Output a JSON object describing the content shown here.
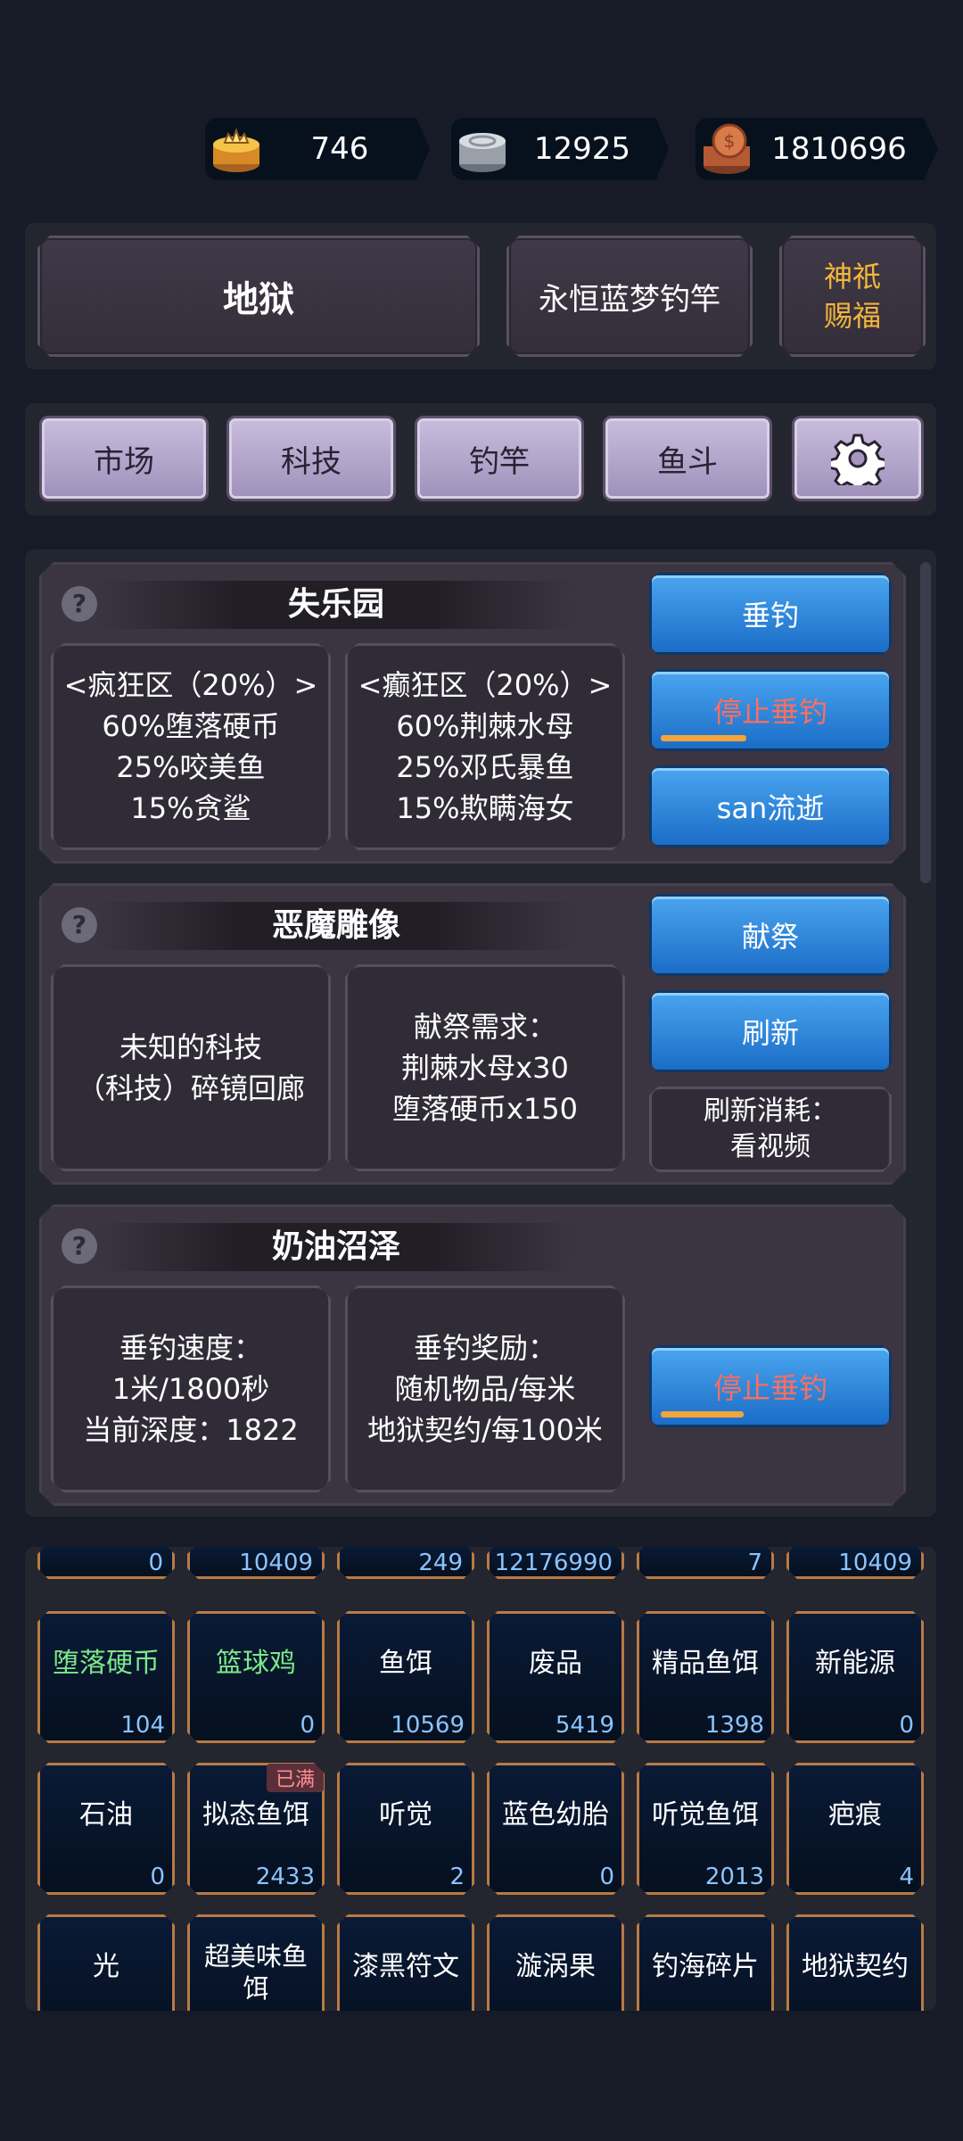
{
  "currencies": [
    {
      "name": "gold-coins",
      "value": "746"
    },
    {
      "name": "silver-coins",
      "value": "12925"
    },
    {
      "name": "copper-coins",
      "value": "1810696"
    }
  ],
  "header": {
    "location": "地狱",
    "rod": "永恒蓝梦钓竿",
    "blessing_line1": "神祇",
    "blessing_line2": "赐福"
  },
  "tabs": [
    "市场",
    "科技",
    "钓竿",
    "鱼斗"
  ],
  "colors": {
    "blessing": "#f3b63a",
    "stop_text": "#ff6e5e",
    "green_item": "#7ce88a",
    "count": "#8cc3ff",
    "progress": "#f3a43a"
  },
  "sections": {
    "paradise": {
      "title": "失乐园",
      "zone1": [
        "<疯狂区（20%）>",
        "60%堕落硬币",
        "25%咬美鱼",
        "15%贪鲨"
      ],
      "zone2": [
        "<癫狂区（20%）>",
        "60%荆棘水母",
        "25%邓氏暴鱼",
        "15%欺瞒海女"
      ],
      "btn_fish": "垂钓",
      "btn_stop": "停止垂钓",
      "stop_progress": 0.38,
      "btn_san": "san流逝"
    },
    "statue": {
      "title": "恶魔雕像",
      "box1": [
        "未知的科技",
        "（科技）碎镜回廊"
      ],
      "box2": [
        "献祭需求：",
        "荆棘水母x30",
        "堕落硬币x150"
      ],
      "btn_offer": "献祭",
      "btn_refresh": "刷新",
      "cost": [
        "刷新消耗：",
        "看视频"
      ]
    },
    "swamp": {
      "title": "奶油沼泽",
      "box1": [
        "垂钓速度：",
        "1米/1800秒",
        "当前深度：1822"
      ],
      "box2": [
        "垂钓奖励：",
        "随机物品/每米",
        "地狱契约/每100米"
      ],
      "btn_stop": "停止垂钓",
      "stop_progress": 0.37
    }
  },
  "inventory": {
    "top_counts": [
      "0",
      "10409",
      "249",
      "12176990",
      "7",
      "10409"
    ],
    "row1": [
      {
        "name": "堕落硬币",
        "count": "104",
        "green": true
      },
      {
        "name": "篮球鸡",
        "count": "0",
        "green": true
      },
      {
        "name": "鱼饵",
        "count": "10569"
      },
      {
        "name": "废品",
        "count": "5419"
      },
      {
        "name": "精品鱼饵",
        "count": "1398"
      },
      {
        "name": "新能源",
        "count": "0"
      }
    ],
    "row2": [
      {
        "name": "石油",
        "count": "0"
      },
      {
        "name": "拟态鱼饵",
        "count": "2433",
        "badge": "已满"
      },
      {
        "name": "听觉",
        "count": "2"
      },
      {
        "name": "蓝色幼胎",
        "count": "0"
      },
      {
        "name": "听觉鱼饵",
        "count": "2013"
      },
      {
        "name": "疤痕",
        "count": "4"
      }
    ],
    "row3": [
      {
        "name": "光"
      },
      {
        "name": "超美味鱼饵"
      },
      {
        "name": "漆黑符文"
      },
      {
        "name": "漩涡果"
      },
      {
        "name": "钓海碎片"
      },
      {
        "name": "地狱契约"
      }
    ]
  }
}
